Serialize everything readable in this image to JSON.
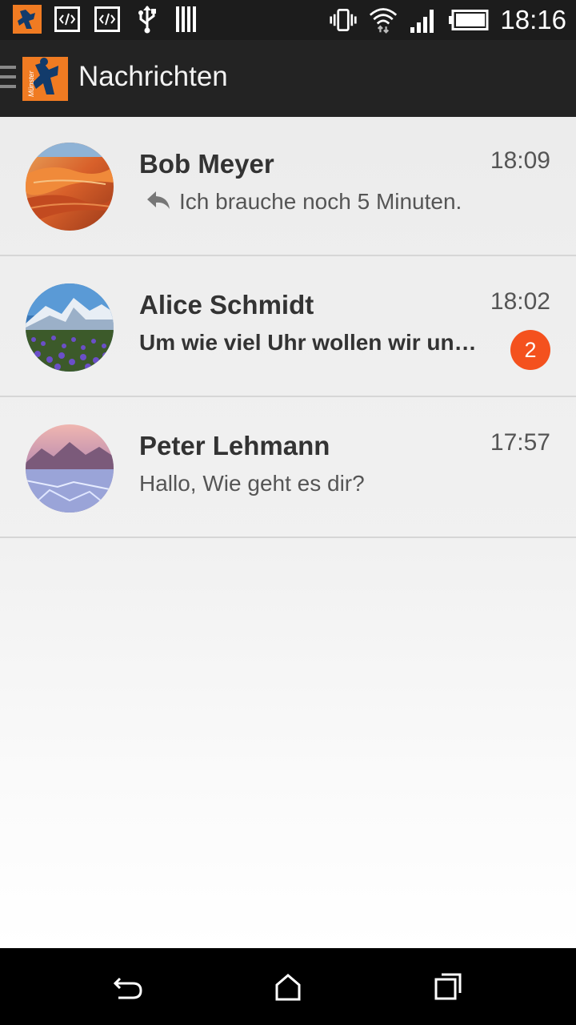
{
  "status_bar": {
    "time": "18:16",
    "left_icons": [
      "app-notification-icon",
      "code-icon",
      "code-icon",
      "usb-icon",
      "bars-icon"
    ],
    "right_icons": [
      "vibrate-icon",
      "wifi-icon",
      "signal-icon",
      "battery-icon"
    ]
  },
  "action_bar": {
    "title": "Nachrichten",
    "logo_text": "Münster"
  },
  "conversations": [
    {
      "name": "Bob Meyer",
      "time": "18:09",
      "message": "Ich brauche noch 5 Minuten.",
      "reply": true,
      "unread_count": null
    },
    {
      "name": "Alice Schmidt",
      "time": "18:02",
      "message": "Um wie viel Uhr wollen wir un…",
      "bold": true,
      "unread_count": "2"
    },
    {
      "name": "Peter Lehmann",
      "time": "17:57",
      "message": "Hallo, Wie geht es dir?"
    }
  ],
  "colors": {
    "accent": "#f4511e",
    "status_bar": "#1c1c1c",
    "action_bar": "#232323",
    "logo_orange": "#f07b22"
  },
  "nav_bar": {
    "buttons": [
      "back-icon",
      "home-icon",
      "recents-icon"
    ]
  }
}
